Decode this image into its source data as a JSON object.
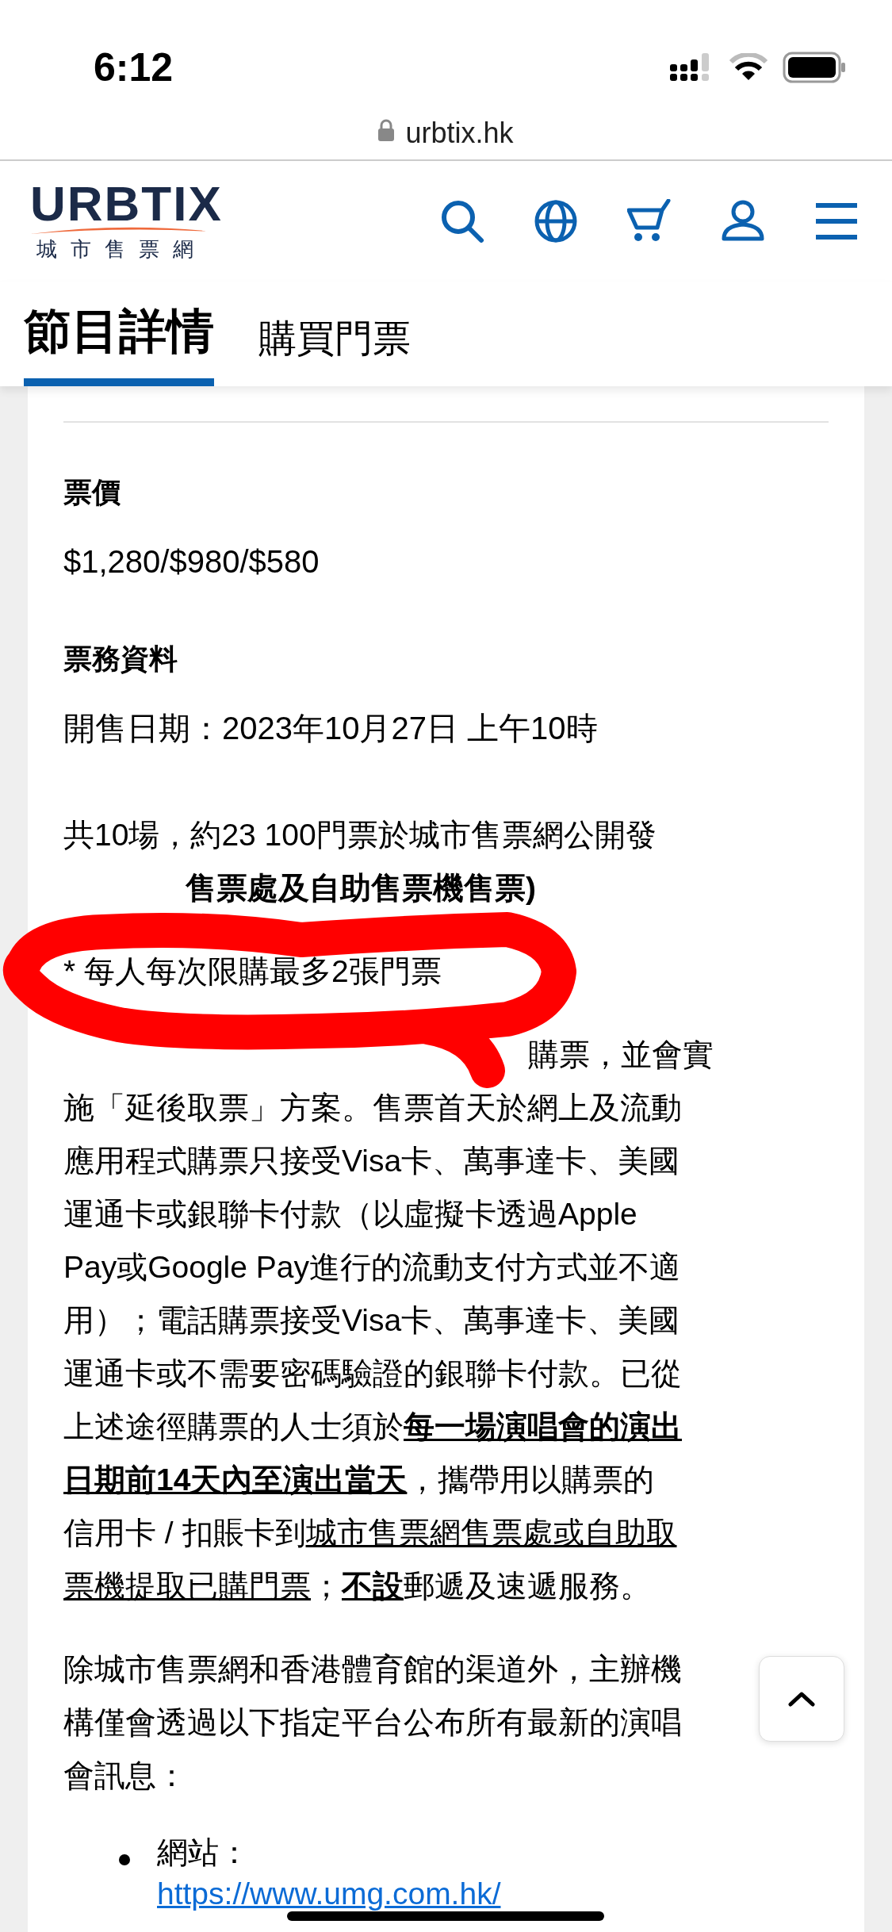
{
  "status_bar": {
    "time": "6:12"
  },
  "address_bar": {
    "url": "urbtix.hk"
  },
  "header": {
    "logo": {
      "wordmark": "URBTIX",
      "tagline": "城市售票網"
    }
  },
  "tabs": [
    {
      "label": "節目詳情",
      "selected": true
    },
    {
      "label": "購買門票",
      "selected": false
    }
  ],
  "sections": [
    {
      "heading": "票價",
      "lines": [
        "$1,280/$980/$580"
      ]
    },
    {
      "heading": "票務資料",
      "lines": [
        "開售日期：2023年10月27日 上午10時"
      ]
    }
  ],
  "paragraphs": [
    {
      "lines": [
        {
          "text": "共10場，約23 100門票於城市售票網公開發",
          "kind": "full",
          "bold": false
        },
        {
          "text": "售票處及自助售票機售票)",
          "kind": "cut_narrow",
          "bold": true
        }
      ]
    },
    {
      "lines": [
        {
          "text": "* 每人每次限購最多2張門票",
          "kind": "full",
          "bold": false
        }
      ]
    },
    {
      "lines": [
        {
          "text": "購票，並會實",
          "kind": "cut_wide",
          "bold": false
        },
        {
          "text": "施「延後取票」方案。售票首天於網上及流動",
          "kind": "full",
          "bold": false
        },
        {
          "text": "應用程式購票只接受Visa卡、萬事達卡、美國",
          "kind": "full",
          "bold": false
        },
        {
          "text": "運通卡或銀聯卡付款（以虛擬卡透過Apple",
          "kind": "full",
          "bold": false
        },
        {
          "text": "Pay或Google Pay進行的流動支付方式並不適",
          "kind": "full",
          "bold": false
        },
        {
          "text": "用）；電話購票接受Visa卡、萬事達卡、美國",
          "kind": "full",
          "bold": false
        },
        {
          "text": "運通卡或不需要密碼驗證的銀聯卡付款。已從",
          "kind": "full",
          "bold": false
        },
        {
          "text": "上述途徑購票的人士須於**每一場演唱會的演出**",
          "kind": "full",
          "bold": false
        },
        {
          "text": "**日期前14天內至演出當天**，攜帶用以購票的",
          "kind": "full",
          "bold": false
        },
        {
          "text": "信用卡 / 扣賬卡到",
          "underlined_tail": "城市售票網售票處或自助取",
          "kind": "full",
          "bold": false
        },
        {
          "text": "*票機提取已購門票*；**不設**郵遞及速遞服務。",
          "kind": "full",
          "bold": false
        }
      ]
    },
    {
      "lines": [
        {
          "text": "除城市售票網和香港體育館的渠道外，主辦機",
          "kind": "full",
          "bold": false
        },
        {
          "text": "構僅會透過以下指定平台公布所有最新的演唱",
          "kind": "full",
          "bold": false
        },
        {
          "text": "會訊息：",
          "kind": "full",
          "bold": false
        }
      ]
    }
  ],
  "bullets": [
    {
      "label": "網站：",
      "link": "https://www.umg.com.hk/"
    }
  ]
}
